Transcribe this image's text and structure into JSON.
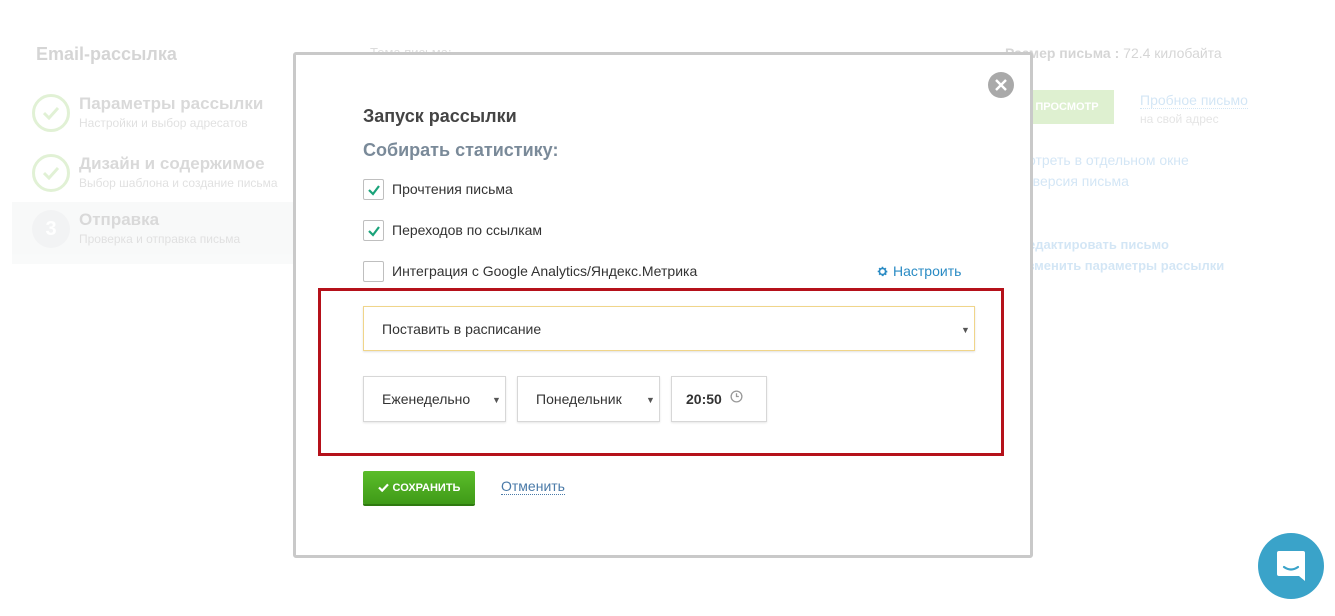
{
  "background": {
    "app_title": "Email-рассылка",
    "steps": [
      {
        "title": "Параметры рассылки",
        "subtitle": "Настройки и выбор адресатов"
      },
      {
        "title": "Дизайн и содержимое",
        "subtitle": "Выбор шаблона и создание письма"
      },
      {
        "title": "Отправка",
        "subtitle": "Проверка и отправка письма",
        "number": "3"
      }
    ],
    "subject_label": "Тема письма:",
    "size_label": "Размер письма :",
    "size_value": "72.4 килобайта",
    "preview_button": "ПРОСМОТР",
    "test_email_link": "Пробное письмо",
    "test_email_sub": "на свой адрес",
    "open_separate": "отреть в отдельном окне",
    "text_version": "-версия письма",
    "edit_letter": "едактировать письмо",
    "change_params": "зменить параметры рассылки"
  },
  "modal": {
    "title": "Запуск рассылки",
    "stats_title": "Собирать статистику:",
    "checkboxes": [
      {
        "label": "Прочтения письма",
        "checked": true
      },
      {
        "label": "Переходов по ссылкам",
        "checked": true
      },
      {
        "label": "Интеграция с Google Analytics/Яндекс.Метрика",
        "checked": false
      }
    ],
    "configure_link": "Настроить",
    "send_mode": "Поставить в расписание",
    "frequency": "Еженедельно",
    "weekday": "Понедельник",
    "time": "20:50",
    "save_button": "СОХРАНИТЬ",
    "cancel_link": "Отменить"
  },
  "colors": {
    "accent_green": "#4caf23",
    "link_blue": "#2a8bc4",
    "highlight_red": "#b5111a",
    "chat_blue": "#3aa3c9"
  }
}
